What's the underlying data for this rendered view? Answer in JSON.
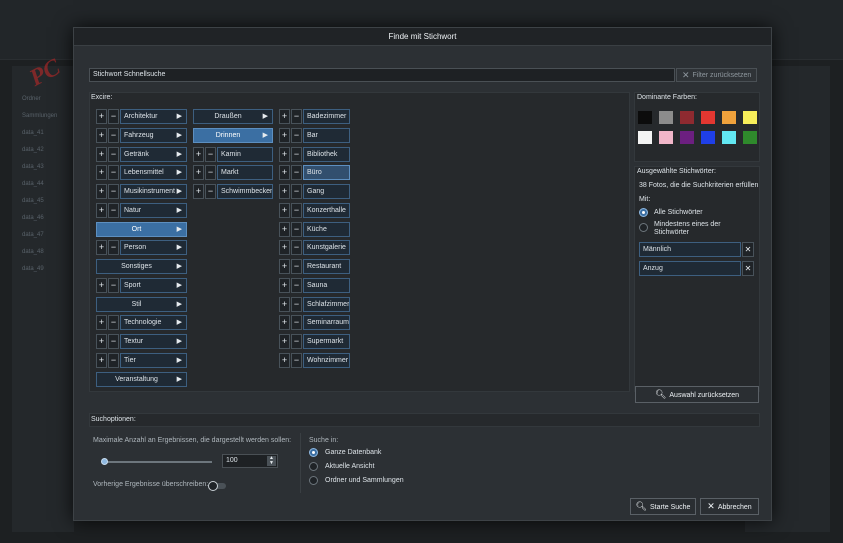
{
  "dialog": {
    "title": "Finde mit Stichwort",
    "search_value": "Stichwort Schnellsuche",
    "reset_filter": "Filter zurücksetzen"
  },
  "keywords": {
    "section_label": "Excire:",
    "column1": [
      {
        "label": "Architektur",
        "pm": true,
        "arrow": true
      },
      {
        "label": "Fahrzeug",
        "pm": true,
        "arrow": true
      },
      {
        "label": "Getränk",
        "pm": true,
        "arrow": true
      },
      {
        "label": "Lebensmittel",
        "pm": true,
        "arrow": true
      },
      {
        "label": "Musikinstrument",
        "pm": true,
        "arrow": true
      },
      {
        "label": "Natur",
        "pm": true,
        "arrow": true
      },
      {
        "label": "Ort",
        "pm": false,
        "arrow": true,
        "state": "selected"
      },
      {
        "label": "Person",
        "pm": true,
        "arrow": true
      },
      {
        "label": "Sonstiges",
        "pm": false,
        "arrow": true
      },
      {
        "label": "Sport",
        "pm": true,
        "arrow": true
      },
      {
        "label": "Stil",
        "pm": false,
        "arrow": true
      },
      {
        "label": "Technologie",
        "pm": true,
        "arrow": true
      },
      {
        "label": "Textur",
        "pm": true,
        "arrow": true
      },
      {
        "label": "Tier",
        "pm": true,
        "arrow": true
      },
      {
        "label": "Veranstaltung",
        "pm": false,
        "arrow": true
      }
    ],
    "column2": [
      {
        "label": "Draußen",
        "pm": false,
        "arrow": true
      },
      {
        "label": "Drinnen",
        "pm": false,
        "arrow": true,
        "state": "selected"
      },
      {
        "label": "Kamin",
        "pm": true,
        "arrow": false
      },
      {
        "label": "Markt",
        "pm": true,
        "arrow": false
      },
      {
        "label": "Schwimmbecken",
        "pm": true,
        "arrow": false
      }
    ],
    "column3": [
      {
        "label": "Badezimmer",
        "pm": true,
        "arrow": false
      },
      {
        "label": "Bar",
        "pm": true,
        "arrow": false
      },
      {
        "label": "Bibliothek",
        "pm": true,
        "arrow": false
      },
      {
        "label": "Büro",
        "pm": true,
        "arrow": false,
        "state": "highlighted"
      },
      {
        "label": "Gang",
        "pm": true,
        "arrow": false
      },
      {
        "label": "Konzerthalle",
        "pm": true,
        "arrow": false
      },
      {
        "label": "Küche",
        "pm": true,
        "arrow": false
      },
      {
        "label": "Kunstgalerie",
        "pm": true,
        "arrow": false
      },
      {
        "label": "Restaurant",
        "pm": true,
        "arrow": false
      },
      {
        "label": "Sauna",
        "pm": true,
        "arrow": false
      },
      {
        "label": "Schlafzimmer",
        "pm": true,
        "arrow": false
      },
      {
        "label": "Seminarraum",
        "pm": true,
        "arrow": false
      },
      {
        "label": "Supermarkt",
        "pm": true,
        "arrow": false
      },
      {
        "label": "Wohnzimmer",
        "pm": true,
        "arrow": false
      }
    ]
  },
  "colors": {
    "label": "Dominante Farben:",
    "swatches": [
      "#0c0c0c",
      "#8c8c8c",
      "#8e2a30",
      "#e33731",
      "#f0a23c",
      "#f7ee5a",
      "#f4f4f4",
      "#f1b6c9",
      "#6c1f80",
      "#1f3fe8",
      "#62e7f2",
      "#2f8a2c"
    ]
  },
  "selected_keywords": {
    "label": "Ausgewählte Stichwörter:",
    "result_text": "38 Fotos, die die Suchkriterien erfüllen",
    "with_label": "Mit:",
    "options": [
      {
        "label": "Alle Stichwörter",
        "checked": true
      },
      {
        "label": "Mindestens eines der Stichwörter",
        "checked": false
      }
    ],
    "tags": [
      "Männlich",
      "Anzug"
    ],
    "reset_button": "Auswahl zurücksetzen"
  },
  "search_options": {
    "label": "Suchoptionen:",
    "max_results_label": "Maximale Anzahl an Ergebnissen, die dargestellt werden sollen:",
    "max_results_value": "100",
    "slider_fraction": 0.02,
    "overwrite_label": "Vorherige Ergebnisse überschreiben:",
    "overwrite_on": false,
    "search_in_label": "Suche in:",
    "scopes": [
      {
        "label": "Ganze Datenbank",
        "checked": true
      },
      {
        "label": "Aktuelle Ansicht",
        "checked": false
      },
      {
        "label": "Ordner und Sammlungen",
        "checked": false
      }
    ]
  },
  "footer": {
    "start_button": "Starte Suche",
    "cancel_button": "Abbrechen"
  },
  "background": {
    "sidebar_rows": [
      "Ordner",
      "Sammlungen",
      "data_41",
      "data_42",
      "data_43",
      "data_44",
      "data_45",
      "data_46",
      "data_47",
      "data_48",
      "data_49"
    ],
    "watermark": "PC"
  }
}
